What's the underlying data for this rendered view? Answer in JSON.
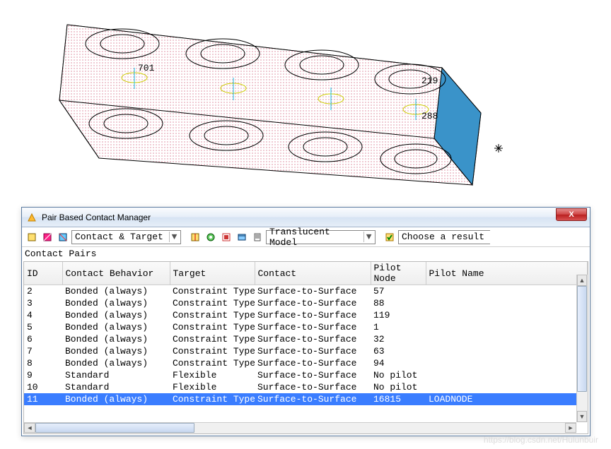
{
  "dialog": {
    "title": "Pair Based Contact Manager",
    "close_label": "X"
  },
  "toolbar": {
    "combo1": "Contact & Target",
    "combo2": "Translucent Model",
    "combo3": "Choose a result "
  },
  "section": "Contact Pairs",
  "columns": {
    "id": "ID",
    "behavior": "Contact Behavior",
    "target": "Target",
    "contact": "Contact",
    "pilot_node": "Pilot Node",
    "pilot_name": "Pilot Name"
  },
  "rows": [
    {
      "id": "2",
      "beh": "Bonded (always)",
      "tgt": "Constraint Type",
      "con": "Surface-to-Surface",
      "pn": "57",
      "pname": ""
    },
    {
      "id": "3",
      "beh": "Bonded (always)",
      "tgt": "Constraint Type",
      "con": "Surface-to-Surface",
      "pn": "88",
      "pname": ""
    },
    {
      "id": "4",
      "beh": "Bonded (always)",
      "tgt": "Constraint Type",
      "con": "Surface-to-Surface",
      "pn": "119",
      "pname": ""
    },
    {
      "id": "5",
      "beh": "Bonded (always)",
      "tgt": "Constraint Type",
      "con": "Surface-to-Surface",
      "pn": "1",
      "pname": ""
    },
    {
      "id": "6",
      "beh": "Bonded (always)",
      "tgt": "Constraint Type",
      "con": "Surface-to-Surface",
      "pn": "32",
      "pname": ""
    },
    {
      "id": "7",
      "beh": "Bonded (always)",
      "tgt": "Constraint Type",
      "con": "Surface-to-Surface",
      "pn": "63",
      "pname": ""
    },
    {
      "id": "8",
      "beh": "Bonded (always)",
      "tgt": "Constraint Type",
      "con": "Surface-to-Surface",
      "pn": "94",
      "pname": ""
    },
    {
      "id": "9",
      "beh": "Standard",
      "tgt": "Flexible",
      "con": "Surface-to-Surface",
      "pn": "No pilot",
      "pname": ""
    },
    {
      "id": "10",
      "beh": "Standard",
      "tgt": "Flexible",
      "con": "Surface-to-Surface",
      "pn": "No pilot",
      "pname": ""
    },
    {
      "id": "11",
      "beh": "Bonded (always)",
      "tgt": "Constraint Type",
      "con": "Surface-to-Surface",
      "pn": "16815",
      "pname": "LOADNODE",
      "selected": true
    }
  ],
  "model_labels": [
    "701",
    "219",
    "288"
  ],
  "watermark": "https://blog.csdn.net/Hulunbuir"
}
